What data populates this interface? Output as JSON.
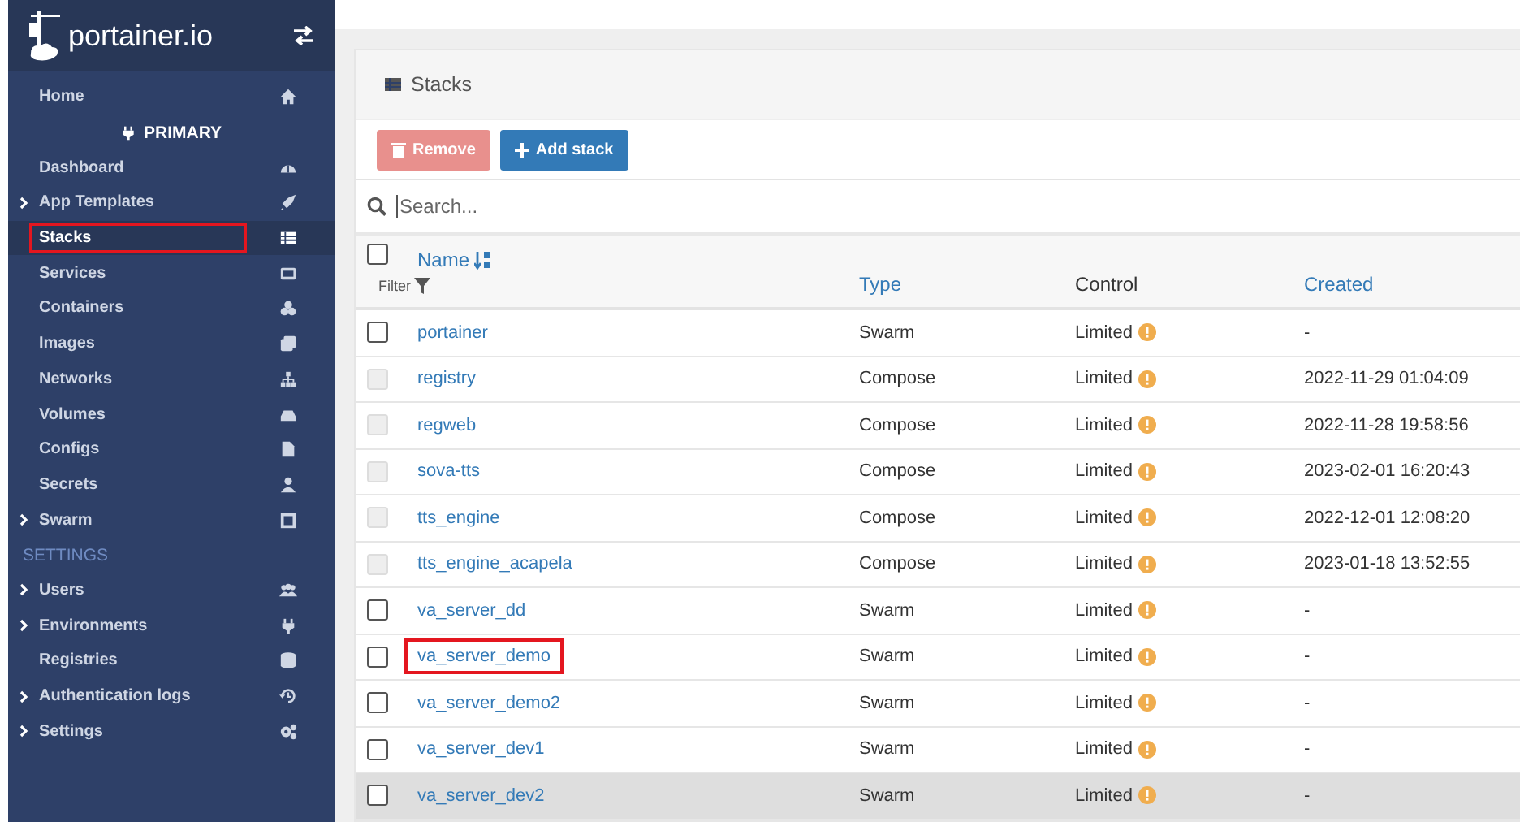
{
  "sidebar": {
    "brand": "portainer.io",
    "items": [
      {
        "kind": "link",
        "label": "Home",
        "expandable": false,
        "selected": false,
        "highlighted": false
      },
      {
        "kind": "section",
        "label": "PRIMARY"
      },
      {
        "kind": "link",
        "label": "Dashboard",
        "expandable": false,
        "selected": false,
        "highlighted": false
      },
      {
        "kind": "link",
        "label": "App Templates",
        "expandable": true,
        "selected": false,
        "highlighted": false
      },
      {
        "kind": "link",
        "label": "Stacks",
        "expandable": false,
        "selected": true,
        "highlighted": true
      },
      {
        "kind": "link",
        "label": "Services",
        "expandable": false,
        "selected": false,
        "highlighted": false
      },
      {
        "kind": "link",
        "label": "Containers",
        "expandable": false,
        "selected": false,
        "highlighted": false
      },
      {
        "kind": "link",
        "label": "Images",
        "expandable": false,
        "selected": false,
        "highlighted": false
      },
      {
        "kind": "link",
        "label": "Networks",
        "expandable": false,
        "selected": false,
        "highlighted": false
      },
      {
        "kind": "link",
        "label": "Volumes",
        "expandable": false,
        "selected": false,
        "highlighted": false
      },
      {
        "kind": "link",
        "label": "Configs",
        "expandable": false,
        "selected": false,
        "highlighted": false
      },
      {
        "kind": "link",
        "label": "Secrets",
        "expandable": false,
        "selected": false,
        "highlighted": false
      },
      {
        "kind": "link",
        "label": "Swarm",
        "expandable": true,
        "selected": false,
        "highlighted": false
      },
      {
        "kind": "heading",
        "label": "SETTINGS"
      },
      {
        "kind": "link",
        "label": "Users",
        "expandable": true,
        "selected": false,
        "highlighted": false
      },
      {
        "kind": "link",
        "label": "Environments",
        "expandable": true,
        "selected": false,
        "highlighted": false
      },
      {
        "kind": "link",
        "label": "Registries",
        "expandable": false,
        "selected": false,
        "highlighted": false
      },
      {
        "kind": "link",
        "label": "Authentication logs",
        "expandable": true,
        "selected": false,
        "highlighted": false
      },
      {
        "kind": "link",
        "label": "Settings",
        "expandable": true,
        "selected": false,
        "highlighted": false
      }
    ]
  },
  "panel": {
    "title": "Stacks",
    "buttons": [
      {
        "label": "Remove",
        "disabled": true
      },
      {
        "label": "Add stack",
        "disabled": false
      }
    ],
    "search": {
      "placeholder": "Search..."
    },
    "select_all": {
      "checked": false
    },
    "columns": {
      "name": "Name",
      "filter": "Filter",
      "type": "Type",
      "control": "Control",
      "created": "Created"
    },
    "rows": [
      {
        "name": "portainer",
        "type": "Swarm",
        "control": "Limited",
        "created": "-",
        "disabled": false,
        "checked": false,
        "highlighted": false,
        "hovered": false
      },
      {
        "name": "registry",
        "type": "Compose",
        "control": "Limited",
        "created": "2022-11-29 01:04:09",
        "disabled": true,
        "checked": false,
        "highlighted": false,
        "hovered": false
      },
      {
        "name": "regweb",
        "type": "Compose",
        "control": "Limited",
        "created": "2022-11-28 19:58:56",
        "disabled": true,
        "checked": false,
        "highlighted": false,
        "hovered": false
      },
      {
        "name": "sova-tts",
        "type": "Compose",
        "control": "Limited",
        "created": "2023-02-01 16:20:43",
        "disabled": true,
        "checked": false,
        "highlighted": false,
        "hovered": false
      },
      {
        "name": "tts_engine",
        "type": "Compose",
        "control": "Limited",
        "created": "2022-12-01 12:08:20",
        "disabled": true,
        "checked": false,
        "highlighted": false,
        "hovered": false
      },
      {
        "name": "tts_engine_acapela",
        "type": "Compose",
        "control": "Limited",
        "created": "2023-01-18 13:52:55",
        "disabled": true,
        "checked": false,
        "highlighted": false,
        "hovered": false
      },
      {
        "name": "va_server_dd",
        "type": "Swarm",
        "control": "Limited",
        "created": "-",
        "disabled": false,
        "checked": false,
        "highlighted": false,
        "hovered": false
      },
      {
        "name": "va_server_demo",
        "type": "Swarm",
        "control": "Limited",
        "created": "-",
        "disabled": false,
        "checked": false,
        "highlighted": true,
        "hovered": false
      },
      {
        "name": "va_server_demo2",
        "type": "Swarm",
        "control": "Limited",
        "created": "-",
        "disabled": false,
        "checked": false,
        "highlighted": false,
        "hovered": false
      },
      {
        "name": "va_server_dev1",
        "type": "Swarm",
        "control": "Limited",
        "created": "-",
        "disabled": false,
        "checked": false,
        "highlighted": false,
        "hovered": false
      },
      {
        "name": "va_server_dev2",
        "type": "Swarm",
        "control": "Limited",
        "created": "-",
        "disabled": false,
        "checked": false,
        "highlighted": false,
        "hovered": true
      }
    ]
  }
}
